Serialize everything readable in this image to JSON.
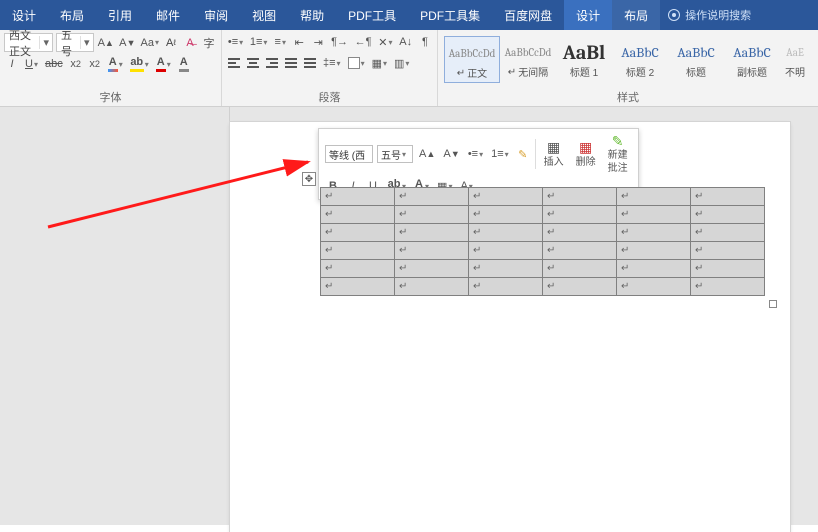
{
  "tabs": {
    "items": [
      {
        "label": "设计"
      },
      {
        "label": "布局"
      },
      {
        "label": "引用"
      },
      {
        "label": "邮件"
      },
      {
        "label": "审阅"
      },
      {
        "label": "视图"
      },
      {
        "label": "帮助"
      },
      {
        "label": "PDF工具"
      },
      {
        "label": "PDF工具集"
      },
      {
        "label": "百度网盘"
      },
      {
        "label": "设计"
      },
      {
        "label": "布局"
      }
    ],
    "tell_me": "操作说明搜索"
  },
  "ribbon": {
    "font": {
      "name_value": "西文正文",
      "size_value": "五号",
      "group_label": "字体"
    },
    "paragraph": {
      "group_label": "段落"
    },
    "styles": {
      "group_label": "样式",
      "items": [
        {
          "preview": "AaBbCcDd",
          "caption": "正文",
          "style": "body",
          "selected": true,
          "mark": true
        },
        {
          "preview": "AaBbCcDd",
          "caption": "无间隔",
          "style": "body",
          "mark": true
        },
        {
          "preview": "AaBl",
          "caption": "标题 1",
          "style": "big"
        },
        {
          "preview": "AaBbC",
          "caption": "标题 2",
          "style": "heading"
        },
        {
          "preview": "AaBbC",
          "caption": "标题",
          "style": "heading"
        },
        {
          "preview": "AaBbC",
          "caption": "副标题",
          "style": "heading"
        },
        {
          "preview": "AaE",
          "caption": "不明"
        }
      ]
    }
  },
  "mini_toolbar": {
    "font_name": "等线 (西",
    "font_size": "五号",
    "insert": "插入",
    "delete": "删除",
    "new_comment_l1": "新建",
    "new_comment_l2": "批注"
  },
  "table": {
    "rows": 6,
    "cols": 6,
    "cell_mark": "↵"
  }
}
